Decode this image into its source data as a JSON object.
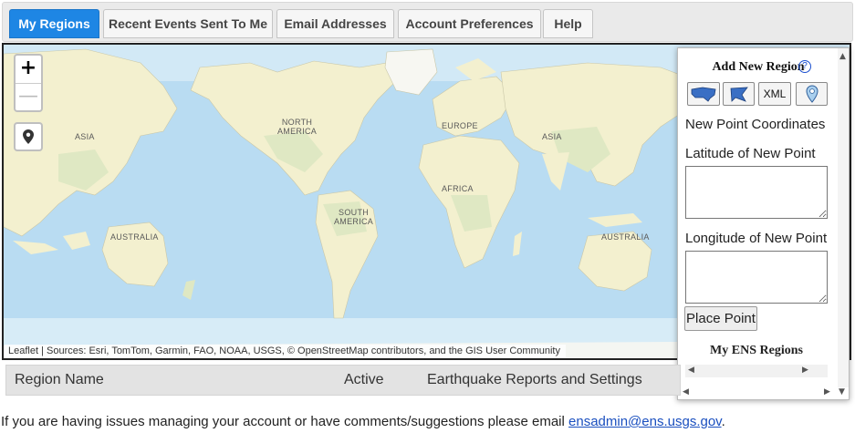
{
  "tabs": [
    {
      "label": "My Regions",
      "active": true
    },
    {
      "label": "Recent Events Sent To Me",
      "active": false
    },
    {
      "label": "Email Addresses",
      "active": false
    },
    {
      "label": "Account Preferences",
      "active": false
    },
    {
      "label": "Help",
      "active": false
    }
  ],
  "map": {
    "zoom_in": "+",
    "zoom_out": "—",
    "labels": {
      "asia_west": "ASIA",
      "north_america": [
        "NORTH",
        "AMERICA"
      ],
      "europe": "EUROPE",
      "asia_east": "ASIA",
      "africa": "AFRICA",
      "south_america": [
        "SOUTH",
        "AMERICA"
      ],
      "australia_west": "AUSTRALIA",
      "australia_east": "AUSTRALIA"
    },
    "attribution": "Leaflet | Sources: Esri, TomTom, Garmin, FAO, NOAA, USGS, © OpenStreetMap contributors, and the GIS User Community",
    "colors": {
      "ocean": "#b9dcf2",
      "land": "#f3f0cf",
      "land_green": "#dfe8c3"
    }
  },
  "panel": {
    "title": "Add New Region",
    "help": "?",
    "tools": {
      "xml": "XML"
    },
    "coordinates_heading": "New Point Coordinates",
    "latitude_label": "Latitude of New Point",
    "longitude_label": "Longitude of New Point",
    "place_button": "Place Point",
    "regions_title": "My ENS Regions"
  },
  "table": {
    "columns": [
      "Region Name",
      "Active",
      "Earthquake Reports and Settings"
    ]
  },
  "footer": {
    "text": "If you are having issues managing your account or have comments/suggestions please email ",
    "email": "ensadmin@ens.usgs.gov",
    "suffix": "."
  },
  "accent_color": "#1e86e4"
}
